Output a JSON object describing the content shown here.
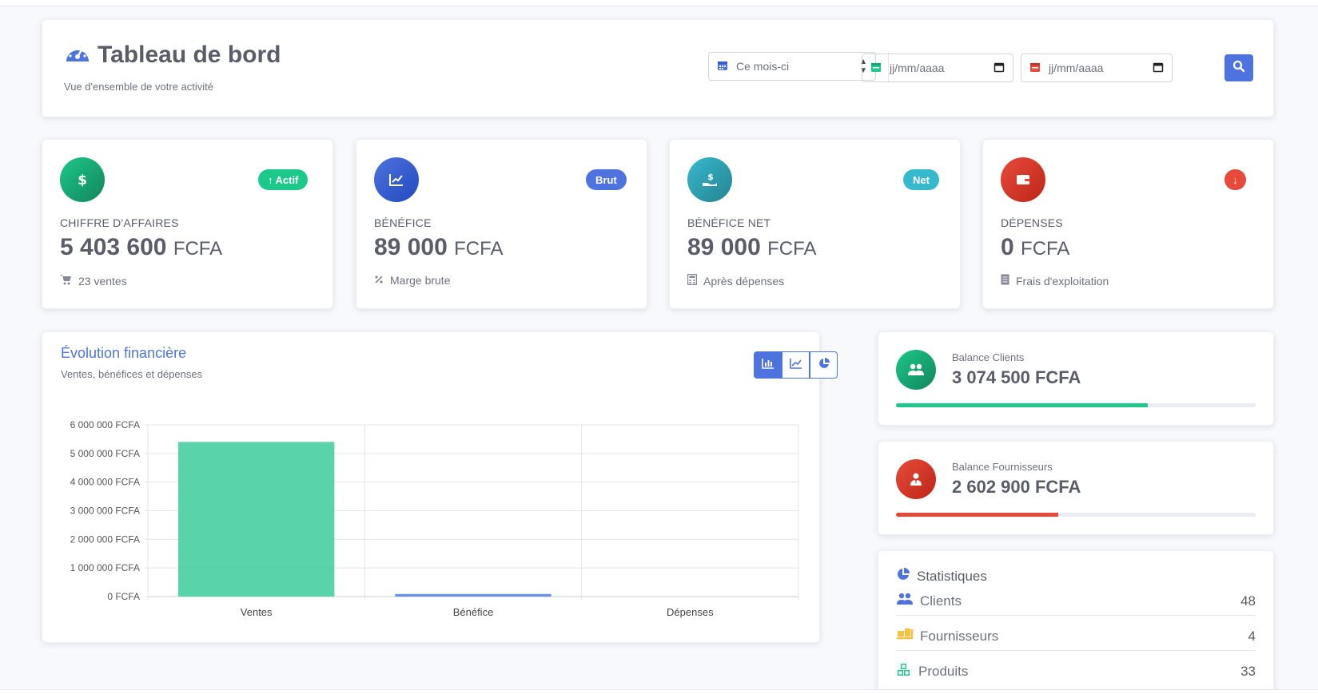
{
  "header": {
    "title": "Tableau de bord",
    "subtitle": "Vue d'ensemble de votre activité",
    "period_select": "Ce mois-ci",
    "date_start_placeholder": "jj/mm/aaaa",
    "date_end_placeholder": "jj/mm/aaaa",
    "icon": "tachometer-icon"
  },
  "kpis": [
    {
      "label": "CHIFFRE D'AFFAIRES",
      "value": "5 403 600",
      "currency": "FCFA",
      "footer": "23 ventes",
      "badge": "Actif",
      "color": "#1cc88a",
      "icon": "dollar-icon"
    },
    {
      "label": "BÉNÉFICE",
      "value": "89 000",
      "currency": "FCFA",
      "footer": "Marge brute",
      "badge": "Brut",
      "color": "#4e73df",
      "icon": "chart-line-icon"
    },
    {
      "label": "BÉNÉFICE NET",
      "value": "89 000",
      "currency": "FCFA",
      "footer": "Après dépenses",
      "badge": "Net",
      "color": "#36b9cc",
      "icon": "hand-coin-icon"
    },
    {
      "label": "DÉPENSES",
      "value": "0",
      "currency": "FCFA",
      "footer": "Frais d'exploitation",
      "badge": "",
      "color": "#e74a3b",
      "icon": "wallet-icon"
    }
  ],
  "chart_section": {
    "title": "Évolution financière",
    "subtitle": "Ventes, bénéfices et dépenses"
  },
  "chart_data": {
    "type": "bar",
    "categories": [
      "Ventes",
      "Bénéfice",
      "Dépenses"
    ],
    "values": [
      5403600,
      89000,
      0
    ],
    "colors": [
      "#4fd1a5",
      "#5b8def",
      "#e74a3b"
    ],
    "ylim": [
      0,
      6000000
    ],
    "yticks": [
      {
        "value": 0,
        "label": "0 FCFA"
      },
      {
        "value": 1000000,
        "label": "1 000 000 FCFA"
      },
      {
        "value": 2000000,
        "label": "2 000 000 FCFA"
      },
      {
        "value": 3000000,
        "label": "3 000 000 FCFA"
      },
      {
        "value": 4000000,
        "label": "4 000 000 FCFA"
      },
      {
        "value": 5000000,
        "label": "5 000 000 FCFA"
      },
      {
        "value": 6000000,
        "label": "6 000 000 FCFA"
      }
    ],
    "grid": true
  },
  "balances": [
    {
      "label": "Balance Clients",
      "value": "3 074 500 FCFA",
      "progress": 0.7,
      "color": "#1cc88a",
      "icon": "users-icon"
    },
    {
      "label": "Balance Fournisseurs",
      "value": "2 602 900 FCFA",
      "progress": 0.45,
      "color": "#e74a3b",
      "icon": "user-tie-icon"
    }
  ],
  "stats": {
    "title": "Statistiques",
    "rows": [
      {
        "label": "Clients",
        "count": "48",
        "icon": "users-icon",
        "color": "#4e73df"
      },
      {
        "label": "Fournisseurs",
        "count": "4",
        "icon": "truck-loading-icon",
        "color": "#f6c23e"
      },
      {
        "label": "Produits",
        "count": "33",
        "icon": "cubes-icon",
        "color": "#1cc88a"
      }
    ]
  }
}
